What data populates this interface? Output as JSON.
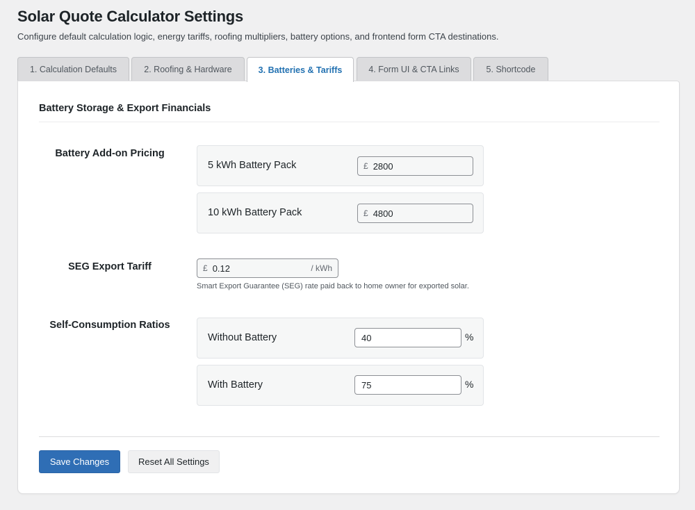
{
  "header": {
    "title": "Solar Quote Calculator Settings",
    "description": "Configure default calculation logic, energy tariffs, roofing multipliers, battery options, and frontend form CTA destinations."
  },
  "tabs": [
    {
      "label": "1. Calculation Defaults",
      "active": false
    },
    {
      "label": "2. Roofing & Hardware",
      "active": false
    },
    {
      "label": "3. Batteries & Tariffs",
      "active": true
    },
    {
      "label": "4. Form UI & CTA Links",
      "active": false
    },
    {
      "label": "5. Shortcode",
      "active": false
    }
  ],
  "section": {
    "title": "Battery Storage & Export Financials"
  },
  "battery_pricing": {
    "label": "Battery Add-on Pricing",
    "items": [
      {
        "label": "5 kWh Battery Pack",
        "currency": "£",
        "value": "2800"
      },
      {
        "label": "10 kWh Battery Pack",
        "currency": "£",
        "value": "4800"
      }
    ]
  },
  "seg_tariff": {
    "label": "SEG Export Tariff",
    "currency": "£",
    "value": "0.12",
    "unit": "/ kWh",
    "help": "Smart Export Guarantee (SEG) rate paid back to home owner for exported solar."
  },
  "self_consumption": {
    "label": "Self-Consumption Ratios",
    "items": [
      {
        "label": "Without Battery",
        "value": "40",
        "unit": "%"
      },
      {
        "label": "With Battery",
        "value": "75",
        "unit": "%"
      }
    ]
  },
  "actions": {
    "save_label": "Save Changes",
    "reset_label": "Reset All Settings"
  },
  "colors": {
    "accent": "#2271b1",
    "primary_button": "#2f6eb5",
    "page_background": "#f0f0f1"
  }
}
